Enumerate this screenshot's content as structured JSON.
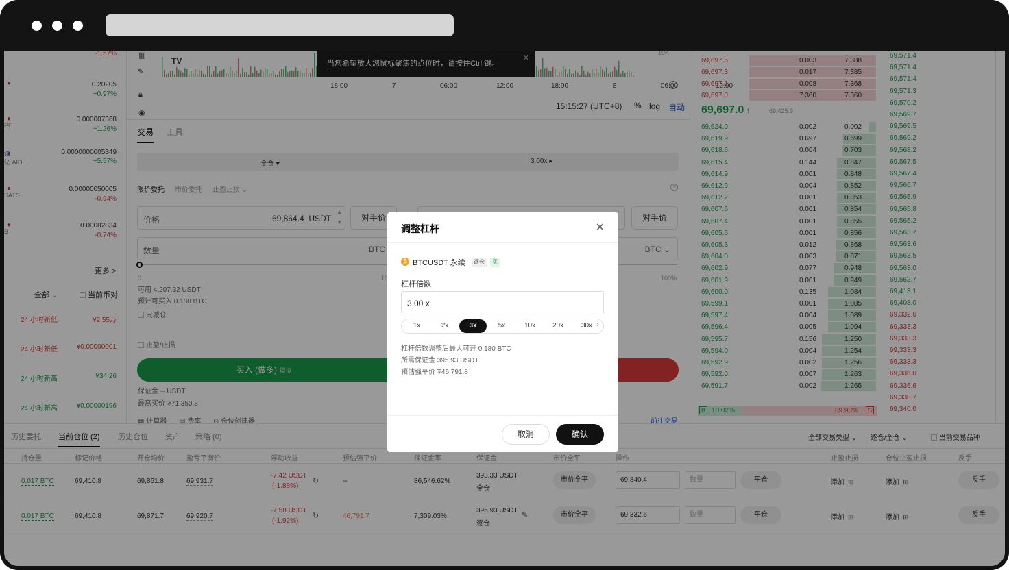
{
  "colors": {
    "buy": "#1a9a4a",
    "sell": "#d93a3a",
    "accent": "#1e5bd6"
  },
  "left_list": [
    {
      "name": "",
      "price": "",
      "change": "-1.57%"
    },
    {
      "name": "",
      "price": "0.20205",
      "change": "+0.97%"
    },
    {
      "name": "PE",
      "price": "0.000007368",
      "change": "+1.26%"
    },
    {
      "name": "亿 AID...",
      "tag": "读",
      "price": "0.0000000005349",
      "change": "+5.57%"
    },
    {
      "name": "SATS",
      "price": "0.00000050005",
      "change": "-0.94%"
    },
    {
      "name": "B",
      "price": "0.00002834",
      "change": "-0.74%"
    }
  ],
  "left_more": "更多 >",
  "left_filter": {
    "all": "全部",
    "current": "当前币对"
  },
  "left_news": [
    {
      "label": "24 小时新低",
      "value": "¥2.55万",
      "color": "sell"
    },
    {
      "label": "24 小时新低",
      "value": "¥0.00000001",
      "color": "sell"
    },
    {
      "label": "24 小时新高",
      "value": "¥34.26",
      "color": "buy"
    },
    {
      "label": "24 小时新高",
      "value": "¥0.00000196",
      "color": "buy"
    }
  ],
  "chart": {
    "time_ticks": [
      "18:00",
      "7",
      "06:00",
      "12:00",
      "18:00",
      "8",
      "06:00",
      "12:00"
    ],
    "tooltip": "当您希望放大您鼠标聚焦的点位时，请按住Ctrl 键。",
    "vol_label": "10K",
    "clock": "15:15:27 (UTC+8)",
    "percent": "%",
    "log": "log",
    "auto": "自动"
  },
  "trade": {
    "tabs": [
      "交易",
      "工具"
    ],
    "margin_mode": "全仓",
    "leverage": "3.00x",
    "order_types": [
      "限价委托",
      "市价委托",
      "止盈止损"
    ],
    "price_label": "价格",
    "price_value": "69,864.4",
    "price_unit": "USDT",
    "counter_price": "对手价",
    "qty_label": "数量",
    "qty_unit": "BTC",
    "slider_start": "0",
    "slider_mid": "10",
    "slider_end": "100%",
    "available": "可用 4,207.32 USDT",
    "can_buy": "预计可买入 0.180 BTC",
    "reduce_only": "只减仓",
    "tp_sl": "止盈/止损",
    "buy_button": "买入 (做多)",
    "buy_sub": "模拟",
    "margin": "保证金 -- USDT",
    "max_buy": "最高买价 ₮71,350.8",
    "tools": [
      "计算器",
      "费率",
      "仓位创建器"
    ],
    "goto": "前往交易"
  },
  "orderbook": {
    "asks": [
      {
        "price": "69,697.5",
        "qty": "0.003",
        "total": "7.388"
      },
      {
        "price": "69,697.3",
        "qty": "0.017",
        "total": "7.385"
      },
      {
        "price": "69,697.1",
        "qty": "0.008",
        "total": "7.368"
      },
      {
        "price": "69,697.0",
        "qty": "7.360",
        "total": "7.360"
      }
    ],
    "last_price": "69,697.0",
    "mark_price": "69,425.9",
    "bids": [
      {
        "price": "69,624.0",
        "qty": "0.002",
        "total": "0.002"
      },
      {
        "price": "69,619.9",
        "qty": "0.697",
        "total": "0.699"
      },
      {
        "price": "69,618.6",
        "qty": "0.004",
        "total": "0.703"
      },
      {
        "price": "69,615.4",
        "qty": "0.144",
        "total": "0.847"
      },
      {
        "price": "69,614.9",
        "qty": "0.001",
        "total": "0.848"
      },
      {
        "price": "69,612.9",
        "qty": "0.004",
        "total": "0.852"
      },
      {
        "price": "69,612.2",
        "qty": "0.001",
        "total": "0.853"
      },
      {
        "price": "69,607.6",
        "qty": "0.001",
        "total": "0.854"
      },
      {
        "price": "69,607.4",
        "qty": "0.001",
        "total": "0.855"
      },
      {
        "price": "69,605.6",
        "qty": "0.001",
        "total": "0.856"
      },
      {
        "price": "69,605.3",
        "qty": "0.012",
        "total": "0.868"
      },
      {
        "price": "69,604.0",
        "qty": "0.003",
        "total": "0.871"
      },
      {
        "price": "69,602.9",
        "qty": "0.077",
        "total": "0.948"
      },
      {
        "price": "69,601.9",
        "qty": "0.001",
        "total": "0.949"
      },
      {
        "price": "69,600.0",
        "qty": "0.135",
        "total": "1.084"
      },
      {
        "price": "69,599.1",
        "qty": "0.001",
        "total": "1.085"
      },
      {
        "price": "69,597.4",
        "qty": "0.004",
        "total": "1.089"
      },
      {
        "price": "69,596.4",
        "qty": "0.005",
        "total": "1.094"
      },
      {
        "price": "69,595.7",
        "qty": "0.156",
        "total": "1.250"
      },
      {
        "price": "69,594.0",
        "qty": "0.004",
        "total": "1.254"
      },
      {
        "price": "69,592.9",
        "qty": "0.002",
        "total": "1.256"
      },
      {
        "price": "69,592.0",
        "qty": "0.007",
        "total": "1.263"
      },
      {
        "price": "69,591.7",
        "qty": "0.002",
        "total": "1.265"
      }
    ],
    "buy_ratio": "10.02%",
    "sell_ratio": "89.98%",
    "b_label": "B",
    "s_label": "S"
  },
  "trades_prices": [
    {
      "p": "69,571.4",
      "c": "buy"
    },
    {
      "p": "69,571.4",
      "c": "buy"
    },
    {
      "p": "69,571.4",
      "c": "buy"
    },
    {
      "p": "69,571.3",
      "c": "buy"
    },
    {
      "p": "69,570.2",
      "c": "buy"
    },
    {
      "p": "69,569.7",
      "c": "buy"
    },
    {
      "p": "69,569.5",
      "c": "buy"
    },
    {
      "p": "69,569.2",
      "c": "buy"
    },
    {
      "p": "69,568.2",
      "c": "buy"
    },
    {
      "p": "69,567.5",
      "c": "buy"
    },
    {
      "p": "69,567.4",
      "c": "buy"
    },
    {
      "p": "69,566.7",
      "c": "buy"
    },
    {
      "p": "69,565.9",
      "c": "buy"
    },
    {
      "p": "69,565.8",
      "c": "buy"
    },
    {
      "p": "69,565.2",
      "c": "buy"
    },
    {
      "p": "69,563.7",
      "c": "buy"
    },
    {
      "p": "69,563.6",
      "c": "buy"
    },
    {
      "p": "69,563.5",
      "c": "buy"
    },
    {
      "p": "69,563.0",
      "c": "buy"
    },
    {
      "p": "69,562.7",
      "c": "buy"
    },
    {
      "p": "69,413.1",
      "c": "buy"
    },
    {
      "p": "69,408.0",
      "c": "buy"
    },
    {
      "p": "69,332.6",
      "c": "sell"
    },
    {
      "p": "69,333.3",
      "c": "sell"
    },
    {
      "p": "69,333.3",
      "c": "sell"
    },
    {
      "p": "69,333.3",
      "c": "sell"
    },
    {
      "p": "69,333.3",
      "c": "sell"
    },
    {
      "p": "69,336.0",
      "c": "sell"
    },
    {
      "p": "69,336.6",
      "c": "sell"
    },
    {
      "p": "69,338.7",
      "c": "sell"
    },
    {
      "p": "69,340.0",
      "c": "sell"
    }
  ],
  "positions": {
    "tabs": [
      "历史委托",
      "当前仓位 (2)",
      "历史仓位",
      "资产",
      "策略 (0)"
    ],
    "filters": [
      "全部交易类型",
      "逐仓/全仓",
      "当前交易品种"
    ],
    "headers": [
      "持仓量",
      "标记价格",
      "开仓均价",
      "盈亏平衡价",
      "浮动收益",
      "预估强平价",
      "保证金率",
      "保证金",
      "市价全平",
      "操作",
      "止盈止损",
      "仓位止盈止损",
      "反手"
    ],
    "rows": [
      {
        "size": "0.017 BTC",
        "mark": "69,410.8",
        "entry": "69,861.8",
        "breakeven": "69,931.7",
        "pnl": "-7.42 USDT",
        "pnl_pct": "(-1.88%)",
        "liq": "--",
        "ratio": "86,546.62%",
        "margin": "393.33 USDT",
        "mode": "全仓",
        "close_all": "市价全平",
        "price_input": "69,840.4",
        "qty_ph": "数量",
        "close": "平仓",
        "tpsl": "添加",
        "pos_tpsl": "添加",
        "reverse": "反手"
      },
      {
        "size": "0.017 BTC",
        "mark": "69,410.8",
        "entry": "69,871.7",
        "breakeven": "69,920.7",
        "pnl": "-7.58 USDT",
        "pnl_pct": "(-1.92%)",
        "liq": "46,791.7",
        "ratio": "7,309.03%",
        "margin": "395.93 USDT",
        "mode": "逐仓",
        "close_all": "市价全平",
        "price_input": "69,332.6",
        "qty_ph": "数量",
        "close": "平仓",
        "tpsl": "添加",
        "pos_tpsl": "添加",
        "reverse": "反手"
      }
    ]
  },
  "modal": {
    "title": "调整杠杆",
    "symbol": "BTCUSDT 永续",
    "mode_tag": "逐仓",
    "side_tag": "买",
    "leverage_label": "杠杆倍数",
    "leverage_value": "3.00 x",
    "options": [
      "1x",
      "2x",
      "3x",
      "5x",
      "10x",
      "20x",
      "30x"
    ],
    "selected": "3x",
    "max_open": "杠杆倍数调整后最大可开 0.180 BTC",
    "required_margin": "所需保证金 395.93 USDT",
    "liq_price": "预估强平价 ₮46,791.8",
    "cancel": "取消",
    "confirm": "确认"
  }
}
